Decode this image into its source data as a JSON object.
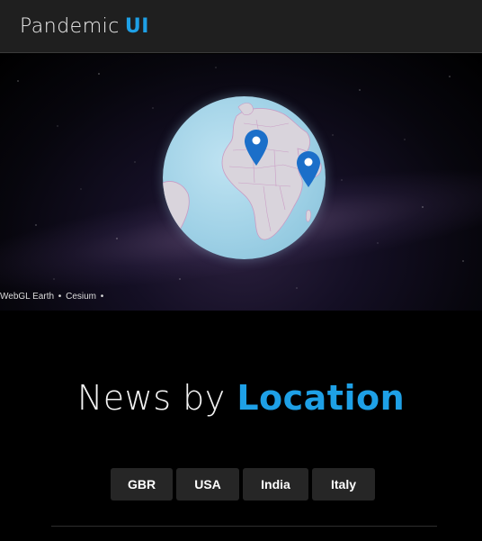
{
  "header": {
    "brand_main": "Pandemic",
    "brand_accent": "UI"
  },
  "globe": {
    "credits": [
      "WebGL Earth",
      "Cesium"
    ],
    "markers": [
      "location-marker",
      "location-marker"
    ]
  },
  "section": {
    "title_main": "News by",
    "title_accent": "Location"
  },
  "locations": [
    {
      "label": "GBR"
    },
    {
      "label": "USA"
    },
    {
      "label": "India"
    },
    {
      "label": "Italy"
    }
  ],
  "colors": {
    "accent": "#1ea0e6",
    "button_bg": "#262626",
    "header_bg": "#1f1f1f"
  }
}
